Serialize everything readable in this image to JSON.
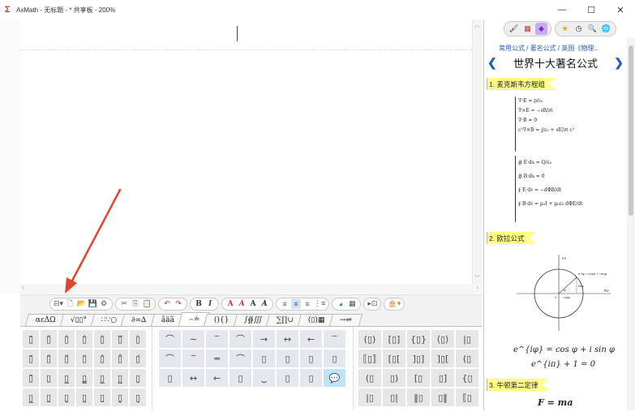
{
  "window": {
    "title": "AxMath - 无标题 - * 共享板 - 200%",
    "controls": [
      "—",
      "☐",
      "✕"
    ]
  },
  "toolbar": {
    "groups": [
      [
        "⊟▾",
        "🗋",
        "📂",
        "💾",
        "⚙"
      ],
      [
        "✂",
        "⎘",
        "📋"
      ],
      [
        "↶",
        "↷"
      ],
      [
        "B",
        "I"
      ],
      [
        "A",
        "A",
        "A",
        "A"
      ],
      [
        "≡",
        "≡",
        "≡",
        "⋮≡"
      ],
      [
        "◕",
        "▦"
      ],
      [
        "▸⊡"
      ],
      [
        "🎂▾"
      ]
    ]
  },
  "tabs": [
    {
      "label": "αεΔΩ",
      "active": false
    },
    {
      "label": "√▯▯°",
      "active": false
    },
    {
      "label": "∷∵○",
      "active": false
    },
    {
      "label": "∂∞∆",
      "active": false
    },
    {
      "label": "âäã",
      "active": false
    },
    {
      "label": "⌢≐",
      "active": true
    },
    {
      "label": "(){}",
      "active": false
    },
    {
      "label": "∫∯∭",
      "active": false
    },
    {
      "label": "∑∏∪",
      "active": false
    },
    {
      "label": "(▯)▦",
      "active": false
    },
    {
      "label": "→⇌",
      "active": false
    }
  ],
  "palette": {
    "accents": [
      "▯̄",
      "▯̃",
      "▯̂",
      "▯̂",
      "▯̂",
      "▯̅",
      "▯̀",
      "▯̄",
      "▯̃",
      "▯̌",
      "▯̆",
      "▯̂",
      "▯̊",
      "▯́",
      "▯̄",
      "▯̱",
      "▯̲",
      "▯̳",
      "▯̲",
      "▯̲",
      "▯̦",
      "▯̲",
      "▯̰",
      "▯̬",
      "▯̭",
      "▯̮",
      "▯̥",
      "▯̗"
    ],
    "overunder": [
      "⌒",
      "∼",
      "‾",
      "⌒",
      "→",
      "↔",
      "←",
      "‾",
      "⌒",
      "‾",
      "═",
      "⌒",
      "▯",
      "▯",
      "▯",
      "▯",
      "▯",
      "↔",
      "←",
      "▯",
      "⏟",
      "▯",
      "▯",
      "💬"
    ],
    "brackets": [
      "(▯)",
      "[▯]",
      "{▯}",
      "⟨▯⟩",
      "|▯",
      "⟦▯⟧",
      "[▯[",
      "]▯]",
      "]▯[",
      "(▯",
      "(▯",
      "▯)",
      "[▯",
      "▯]",
      "{▯",
      "|▯",
      "▯|",
      "‖▯",
      "▯‖",
      "⟦▯"
    ]
  },
  "panel": {
    "toolbar_icons": [
      "🖌",
      "▦",
      "◆",
      "★",
      "◷",
      "🔍",
      "🌐"
    ],
    "breadcrumb": "常用公式 / 著名公式 / 英国《物理...",
    "prev": "❮",
    "next": "❯",
    "title": "世界十大著名公式",
    "sections": [
      {
        "label": "1. 麦克斯韦方程组"
      },
      {
        "label": "2. 欧拉公式"
      },
      {
        "label": "3. 牛顿第二定律"
      }
    ],
    "maxwell_differential": [
      "∇·E = ρ/ε₀",
      "∇×E = −∂B/∂t",
      "∇·B = 0",
      "c²∇×B = j/ε₀ + ∂E/∂t c²"
    ],
    "maxwell_integral": [
      "∯ E·ds = Q/ε₀",
      "∯ B·ds = 0",
      "∮ E·dℓ = −dΦB/dt",
      "∮ B·dℓ = μ₀I + μ₀ε₀ dΦE/dt"
    ],
    "euler_diagram_labels": {
      "axis_im": "Im",
      "axis_re": "Re",
      "point": "e^iφ = cosφ + i sinφ",
      "sin": "sinφ",
      "cos": "cosφ",
      "origin": "0",
      "angle": "φ"
    },
    "euler_lines": [
      "e^{iφ} = cos φ + i sin φ",
      "e^{iπ} + 1 = 0"
    ],
    "newton": "F = ma"
  },
  "colors": {
    "accent": "#1f5fbf",
    "section_highlight": "#ffff88",
    "arrow": "#e5442c"
  }
}
